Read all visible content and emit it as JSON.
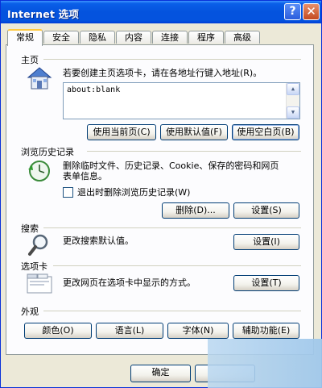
{
  "window": {
    "title": "Internet 选项"
  },
  "titlebar": {
    "help_glyph": "?",
    "close_glyph": "✕"
  },
  "tabs": [
    {
      "label": "常规"
    },
    {
      "label": "安全"
    },
    {
      "label": "隐私"
    },
    {
      "label": "内容"
    },
    {
      "label": "连接"
    },
    {
      "label": "程序"
    },
    {
      "label": "高级"
    }
  ],
  "home": {
    "title": "主页",
    "desc": "若要创建主页选项卡，请在各地址行键入地址(R)。",
    "url": "about:blank",
    "btn_current": "使用当前页(C)",
    "btn_default": "使用默认值(F)",
    "btn_blank": "使用空白页(B)"
  },
  "history": {
    "title": "浏览历史记录",
    "desc_line1": "删除临时文件、历史记录、Cookie、保存的密码和网页",
    "desc_line2": "表单信息。",
    "checkbox_label": "退出时删除浏览历史记录(W)",
    "btn_delete": "删除(D)...",
    "btn_settings": "设置(S)"
  },
  "search": {
    "title": "搜索",
    "desc": "更改搜索默认值。",
    "btn_settings": "设置(I)"
  },
  "tabsection": {
    "title": "选项卡",
    "desc": "更改网页在选项卡中显示的方式。",
    "btn_settings": "设置(T)"
  },
  "appearance": {
    "title": "外观",
    "btn_colors": "颜色(O)",
    "btn_languages": "语言(L)",
    "btn_fonts": "字体(N)",
    "btn_accessibility": "辅助功能(E)"
  },
  "footer": {
    "ok": "确定"
  },
  "colors": {
    "titlebar": "#0453de",
    "dialog": "#ece9d8",
    "panel": "#fcfcfe",
    "tab_highlight": "#ffc83c"
  }
}
